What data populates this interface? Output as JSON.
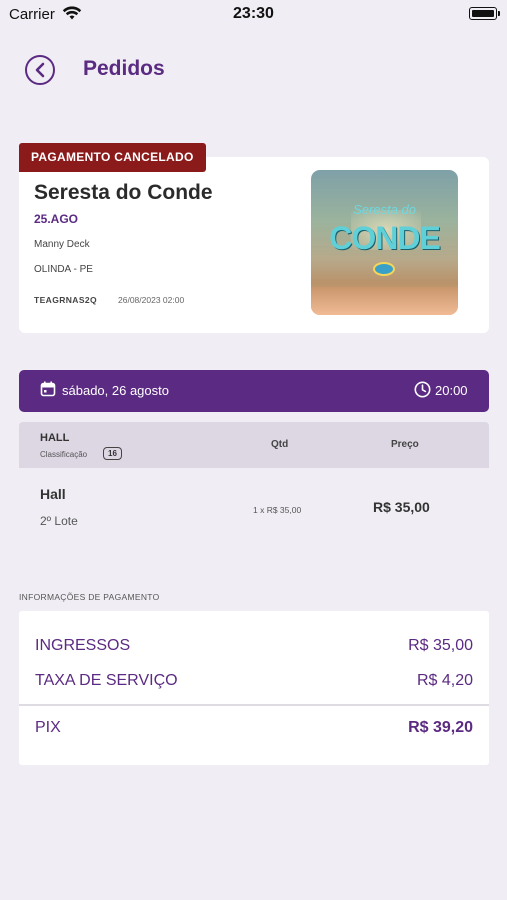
{
  "status_bar": {
    "carrier": "Carrier",
    "time": "23:30"
  },
  "header": {
    "title": "Pedidos"
  },
  "order": {
    "status": "PAGAMENTO CANCELADO",
    "status_color": "#8b1a1a",
    "event_title": "Seresta do Conde",
    "event_date": "25.AGO",
    "artist": "Manny Deck",
    "location": "OLINDA - PE",
    "code": "TEAGRNAS2Q",
    "datetime": "26/08/2023 02:00",
    "image": {
      "script_text": "Seresta do",
      "big_text": "CONDE"
    }
  },
  "session": {
    "date": "sábado, 26 agosto",
    "time": "20:00"
  },
  "tickets": {
    "headers": {
      "sector": "HALL",
      "classification": "Classificação",
      "age": "16",
      "qty": "Qtd",
      "price": "Preço"
    },
    "rows": [
      {
        "name": "Hall",
        "lot": "2º Lote",
        "qty": "1 x R$ 35,00",
        "price": "R$ 35,00"
      }
    ]
  },
  "payment": {
    "section_label": "INFORMAÇÕES DE PAGAMENTO",
    "tickets_label": "INGRESSOS",
    "tickets_value": "R$ 35,00",
    "fee_label": "TAXA DE SERVIÇO",
    "fee_value": "R$ 4,20",
    "method_label": "PIX",
    "total_value": "R$ 39,20"
  },
  "colors": {
    "primary": "#5b2a82",
    "background": "#f0eef4",
    "danger": "#8b1a1a"
  }
}
